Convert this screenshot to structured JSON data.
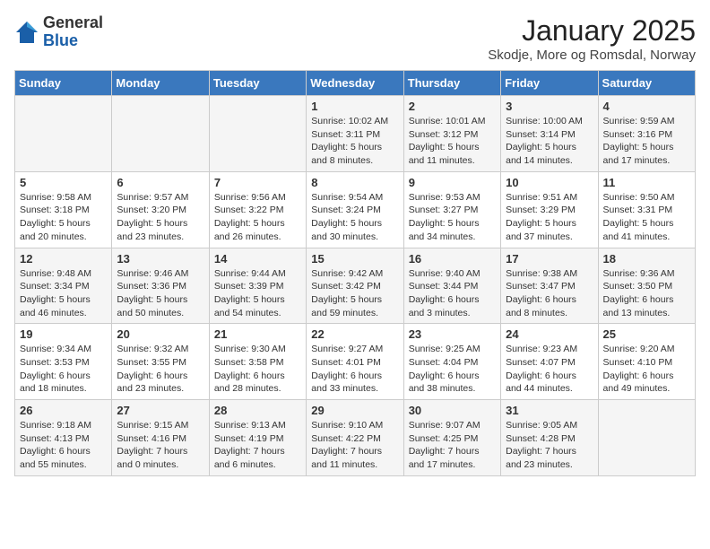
{
  "logo": {
    "general": "General",
    "blue": "Blue"
  },
  "header": {
    "month": "January 2025",
    "location": "Skodje, More og Romsdal, Norway"
  },
  "days_of_week": [
    "Sunday",
    "Monday",
    "Tuesday",
    "Wednesday",
    "Thursday",
    "Friday",
    "Saturday"
  ],
  "weeks": [
    [
      {
        "day": "",
        "info": ""
      },
      {
        "day": "",
        "info": ""
      },
      {
        "day": "",
        "info": ""
      },
      {
        "day": "1",
        "info": "Sunrise: 10:02 AM\nSunset: 3:11 PM\nDaylight: 5 hours and 8 minutes."
      },
      {
        "day": "2",
        "info": "Sunrise: 10:01 AM\nSunset: 3:12 PM\nDaylight: 5 hours and 11 minutes."
      },
      {
        "day": "3",
        "info": "Sunrise: 10:00 AM\nSunset: 3:14 PM\nDaylight: 5 hours and 14 minutes."
      },
      {
        "day": "4",
        "info": "Sunrise: 9:59 AM\nSunset: 3:16 PM\nDaylight: 5 hours and 17 minutes."
      }
    ],
    [
      {
        "day": "5",
        "info": "Sunrise: 9:58 AM\nSunset: 3:18 PM\nDaylight: 5 hours and 20 minutes."
      },
      {
        "day": "6",
        "info": "Sunrise: 9:57 AM\nSunset: 3:20 PM\nDaylight: 5 hours and 23 minutes."
      },
      {
        "day": "7",
        "info": "Sunrise: 9:56 AM\nSunset: 3:22 PM\nDaylight: 5 hours and 26 minutes."
      },
      {
        "day": "8",
        "info": "Sunrise: 9:54 AM\nSunset: 3:24 PM\nDaylight: 5 hours and 30 minutes."
      },
      {
        "day": "9",
        "info": "Sunrise: 9:53 AM\nSunset: 3:27 PM\nDaylight: 5 hours and 34 minutes."
      },
      {
        "day": "10",
        "info": "Sunrise: 9:51 AM\nSunset: 3:29 PM\nDaylight: 5 hours and 37 minutes."
      },
      {
        "day": "11",
        "info": "Sunrise: 9:50 AM\nSunset: 3:31 PM\nDaylight: 5 hours and 41 minutes."
      }
    ],
    [
      {
        "day": "12",
        "info": "Sunrise: 9:48 AM\nSunset: 3:34 PM\nDaylight: 5 hours and 46 minutes."
      },
      {
        "day": "13",
        "info": "Sunrise: 9:46 AM\nSunset: 3:36 PM\nDaylight: 5 hours and 50 minutes."
      },
      {
        "day": "14",
        "info": "Sunrise: 9:44 AM\nSunset: 3:39 PM\nDaylight: 5 hours and 54 minutes."
      },
      {
        "day": "15",
        "info": "Sunrise: 9:42 AM\nSunset: 3:42 PM\nDaylight: 5 hours and 59 minutes."
      },
      {
        "day": "16",
        "info": "Sunrise: 9:40 AM\nSunset: 3:44 PM\nDaylight: 6 hours and 3 minutes."
      },
      {
        "day": "17",
        "info": "Sunrise: 9:38 AM\nSunset: 3:47 PM\nDaylight: 6 hours and 8 minutes."
      },
      {
        "day": "18",
        "info": "Sunrise: 9:36 AM\nSunset: 3:50 PM\nDaylight: 6 hours and 13 minutes."
      }
    ],
    [
      {
        "day": "19",
        "info": "Sunrise: 9:34 AM\nSunset: 3:53 PM\nDaylight: 6 hours and 18 minutes."
      },
      {
        "day": "20",
        "info": "Sunrise: 9:32 AM\nSunset: 3:55 PM\nDaylight: 6 hours and 23 minutes."
      },
      {
        "day": "21",
        "info": "Sunrise: 9:30 AM\nSunset: 3:58 PM\nDaylight: 6 hours and 28 minutes."
      },
      {
        "day": "22",
        "info": "Sunrise: 9:27 AM\nSunset: 4:01 PM\nDaylight: 6 hours and 33 minutes."
      },
      {
        "day": "23",
        "info": "Sunrise: 9:25 AM\nSunset: 4:04 PM\nDaylight: 6 hours and 38 minutes."
      },
      {
        "day": "24",
        "info": "Sunrise: 9:23 AM\nSunset: 4:07 PM\nDaylight: 6 hours and 44 minutes."
      },
      {
        "day": "25",
        "info": "Sunrise: 9:20 AM\nSunset: 4:10 PM\nDaylight: 6 hours and 49 minutes."
      }
    ],
    [
      {
        "day": "26",
        "info": "Sunrise: 9:18 AM\nSunset: 4:13 PM\nDaylight: 6 hours and 55 minutes."
      },
      {
        "day": "27",
        "info": "Sunrise: 9:15 AM\nSunset: 4:16 PM\nDaylight: 7 hours and 0 minutes."
      },
      {
        "day": "28",
        "info": "Sunrise: 9:13 AM\nSunset: 4:19 PM\nDaylight: 7 hours and 6 minutes."
      },
      {
        "day": "29",
        "info": "Sunrise: 9:10 AM\nSunset: 4:22 PM\nDaylight: 7 hours and 11 minutes."
      },
      {
        "day": "30",
        "info": "Sunrise: 9:07 AM\nSunset: 4:25 PM\nDaylight: 7 hours and 17 minutes."
      },
      {
        "day": "31",
        "info": "Sunrise: 9:05 AM\nSunset: 4:28 PM\nDaylight: 7 hours and 23 minutes."
      },
      {
        "day": "",
        "info": ""
      }
    ]
  ]
}
